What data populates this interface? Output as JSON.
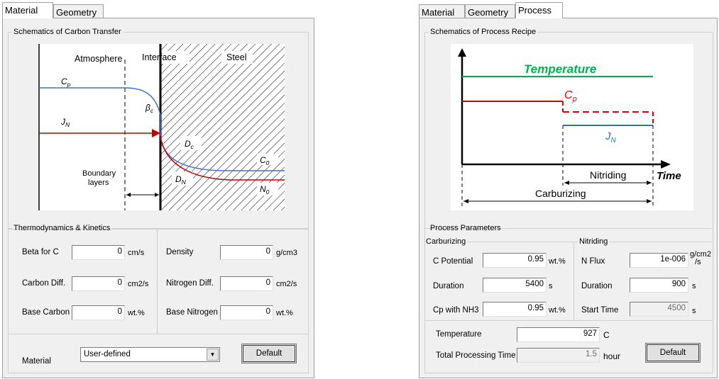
{
  "left": {
    "tabs": [
      {
        "label": "Material",
        "active": true
      },
      {
        "label": "Geometry",
        "active": false
      }
    ],
    "schematic": {
      "title": "Schematics of Carbon Transfer",
      "atmosphere": "Atmosphere",
      "interface": "Interface",
      "steel": "Steel",
      "cp": "C",
      "cp_sub": "p",
      "jn": "J",
      "jn_sub": "N",
      "beta": "β",
      "beta_sub": "c",
      "dc": "D",
      "dc_sub": "c",
      "dn": "D",
      "dn_sub": "N",
      "c0": "C",
      "c0_sub": "0",
      "n0": "N",
      "n0_sub": "0",
      "boundary_line1": "Boundary",
      "boundary_line2": "layers"
    },
    "thermo": {
      "title": "Thermodynamics & Kinetics",
      "beta_label": "Beta for C",
      "beta_value": "0",
      "beta_unit": "cm/s",
      "carbon_diff_label": "Carbon Diff.",
      "carbon_diff_value": "0",
      "carbon_diff_unit": "cm2/s",
      "base_carbon_label": "Base Carbon",
      "base_carbon_value": "0",
      "base_carbon_unit": "wt.%",
      "density_label": "Density",
      "density_value": "0",
      "density_unit": "g/cm3",
      "nitrogen_diff_label": "Nitrogen Diff.",
      "nitrogen_diff_value": "0",
      "nitrogen_diff_unit": "cm2/s",
      "base_nitrogen_label": "Base Nitrogen",
      "base_nitrogen_value": "0",
      "base_nitrogen_unit": "wt.%"
    },
    "material_label": "Material",
    "material_selected": "User-defined",
    "default_button": "Default"
  },
  "right": {
    "tabs": [
      {
        "label": "Material",
        "active": false
      },
      {
        "label": "Geometry",
        "active": false
      },
      {
        "label": "Process",
        "active": true
      }
    ],
    "schematic": {
      "title": "Schematics of Process Recipe",
      "temperature": "Temperature",
      "cp": "C",
      "cp_sub": "p",
      "jn": "J",
      "jn_sub": "N",
      "nitriding": "Nitriding",
      "time": "Time",
      "carburizing": "Carburizing",
      "colors": {
        "temperature": "#00b050",
        "cp": "#e00000",
        "jn": "#2e75b6"
      }
    },
    "params": {
      "title": "Process Parameters",
      "carburizing_title": "Carburizing",
      "nitriding_title": "Nitriding",
      "c_potential_label": "C Potential",
      "c_potential_value": "0.95",
      "c_potential_unit": "wt.%",
      "duration_label": "Duration",
      "duration_value": "5400",
      "duration_unit": "s",
      "cp_nh3_label": "Cp with NH3",
      "cp_nh3_value": "0.95",
      "cp_nh3_unit": "wt.%",
      "n_flux_label": "N Flux",
      "n_flux_value": "1e-006",
      "n_flux_unit_top": "g/cm2",
      "n_flux_unit_bottom": "/s",
      "n_duration_label": "Duration",
      "n_duration_value": "900",
      "n_duration_unit": "s",
      "start_time_label": "Start Time",
      "start_time_value": "4500",
      "start_time_unit": "s"
    },
    "temperature_label": "Temperature",
    "temperature_value": "927",
    "temperature_unit": "C",
    "total_time_label": "Total Processing Time",
    "total_time_value": "1.5",
    "total_time_unit": "hour",
    "default_button": "Default"
  }
}
